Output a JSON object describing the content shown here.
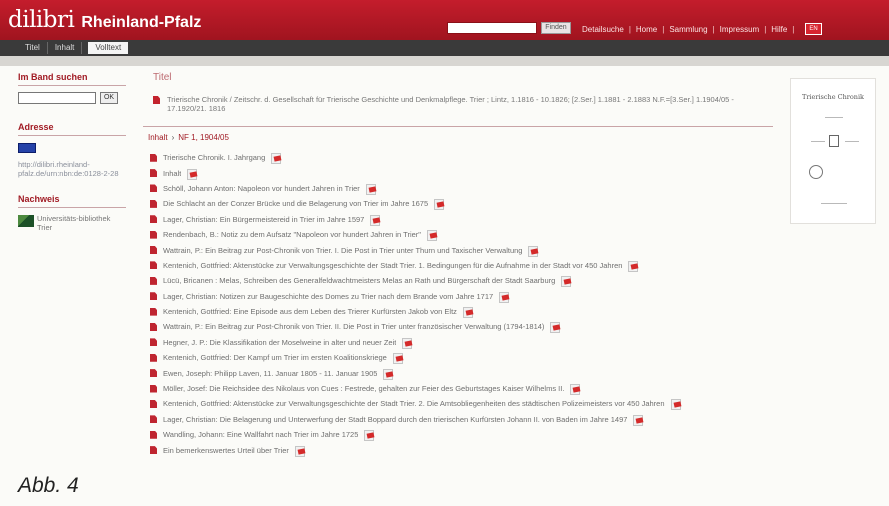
{
  "header": {
    "logo_mark": "dilibri",
    "region": "Rheinland-Pfalz",
    "search_button": "Finden",
    "nav": [
      "Detailsuche",
      "Home",
      "Sammlung",
      "Impressum",
      "Hilfe"
    ],
    "lang_badge": "EN"
  },
  "tabs": [
    "Titel",
    "Inhalt",
    "Volltext"
  ],
  "sidebar": {
    "search_heading": "Im Band suchen",
    "ok_label": "OK",
    "address_heading": "Adresse",
    "address_link": "http://dilibri.rheinland-pfalz.de/urn:nbn:de:0128-2-28",
    "nachweis_heading": "Nachweis",
    "nachweis_text": "Universitäts-bibliothek Trier"
  },
  "main": {
    "title_heading": "Titel",
    "bibliography": "Trierische Chronik / Zeitschr. d. Gesellschaft für Trierische Geschichte und Denkmalpflege. Trier ; Lintz, 1.1816 - 10.1826; [2.Ser.] 1.1881 - 2.1883 N.F.=[3.Ser.] 1.1904/05 - 17.1920/21. 1816",
    "contents_label": "Inhalt",
    "contents_volume": "NF 1, 1904/05",
    "entries": [
      "Trierische Chronik. I. Jahrgang",
      "Inhalt",
      "Schöll, Johann Anton: Napoleon vor hundert Jahren in Trier",
      "Die Schlacht an der Conzer Brücke und die Belagerung von Trier im Jahre 1675",
      "Lager, Christian: Ein Bürgermeistereid in Trier im Jahre 1597",
      "Rendenbach, B.: Notiz zu dem Aufsatz \"Napoleon vor hundert Jahren in Trier\"",
      "Wattrain, P.: Ein Beitrag zur Post-Chronik von Trier. I. Die Post in Trier unter Thurn und Taxischer Verwaltung",
      "Kentenich, Gottfried: Aktenstücke zur Verwaltungsgeschichte der Stadt Trier. 1. Bedingungen für die Aufnahme in der Stadt vor 450 Jahren",
      "Lücü, Bricanen : Melas, Schreiben des Generalfeldwachtmeisters Melas an Rath und Bürgerschaft der Stadt Saarburg",
      "Lager, Christian: Notizen zur Baugeschichte des Domes zu Trier nach dem Brande vom Jahre 1717",
      "Kentenich, Gottfried: Eine Episode aus dem Leben des Trierer Kurfürsten Jakob von Eltz",
      "Wattrain, P.: Ein Beitrag zur Post-Chronik von Trier. II. Die Post in Trier unter französischer Verwaltung (1794-1814)",
      "Hegner, J. P.: Die Klassifikation der Moselweine in alter und neuer Zeit",
      "Kentenich, Gottfried: Der Kampf um Trier im ersten Koalitionskriege",
      "Ewen, Joseph: Philipp Laven, 11. Januar 1805 - 11. Januar 1905",
      "Möller, Josef: Die Reichsidee des Nikolaus von Cues : Festrede, gehalten zur Feier des Geburtstages Kaiser Wilhelms II.",
      "Kentenich, Gottfried: Aktenstücke zur Verwaltungsgeschichte der Stadt Trier. 2. Die Amtsobliegenheiten des städtischen Polizeimeisters vor 450 Jahren",
      "Lager, Christian: Die Belagerung und Unterwerfung der Stadt Boppard durch den trierischen Kurfürsten Johann II. von Baden im Jahre 1497",
      "Wandling, Johann: Eine Wallfahrt nach Trier im Jahre 1725",
      "Ein bemerkenswertes Urteil über Trier"
    ]
  },
  "thumbnail": {
    "title": "Trierische Chronik"
  },
  "caption": "Abb. 4"
}
